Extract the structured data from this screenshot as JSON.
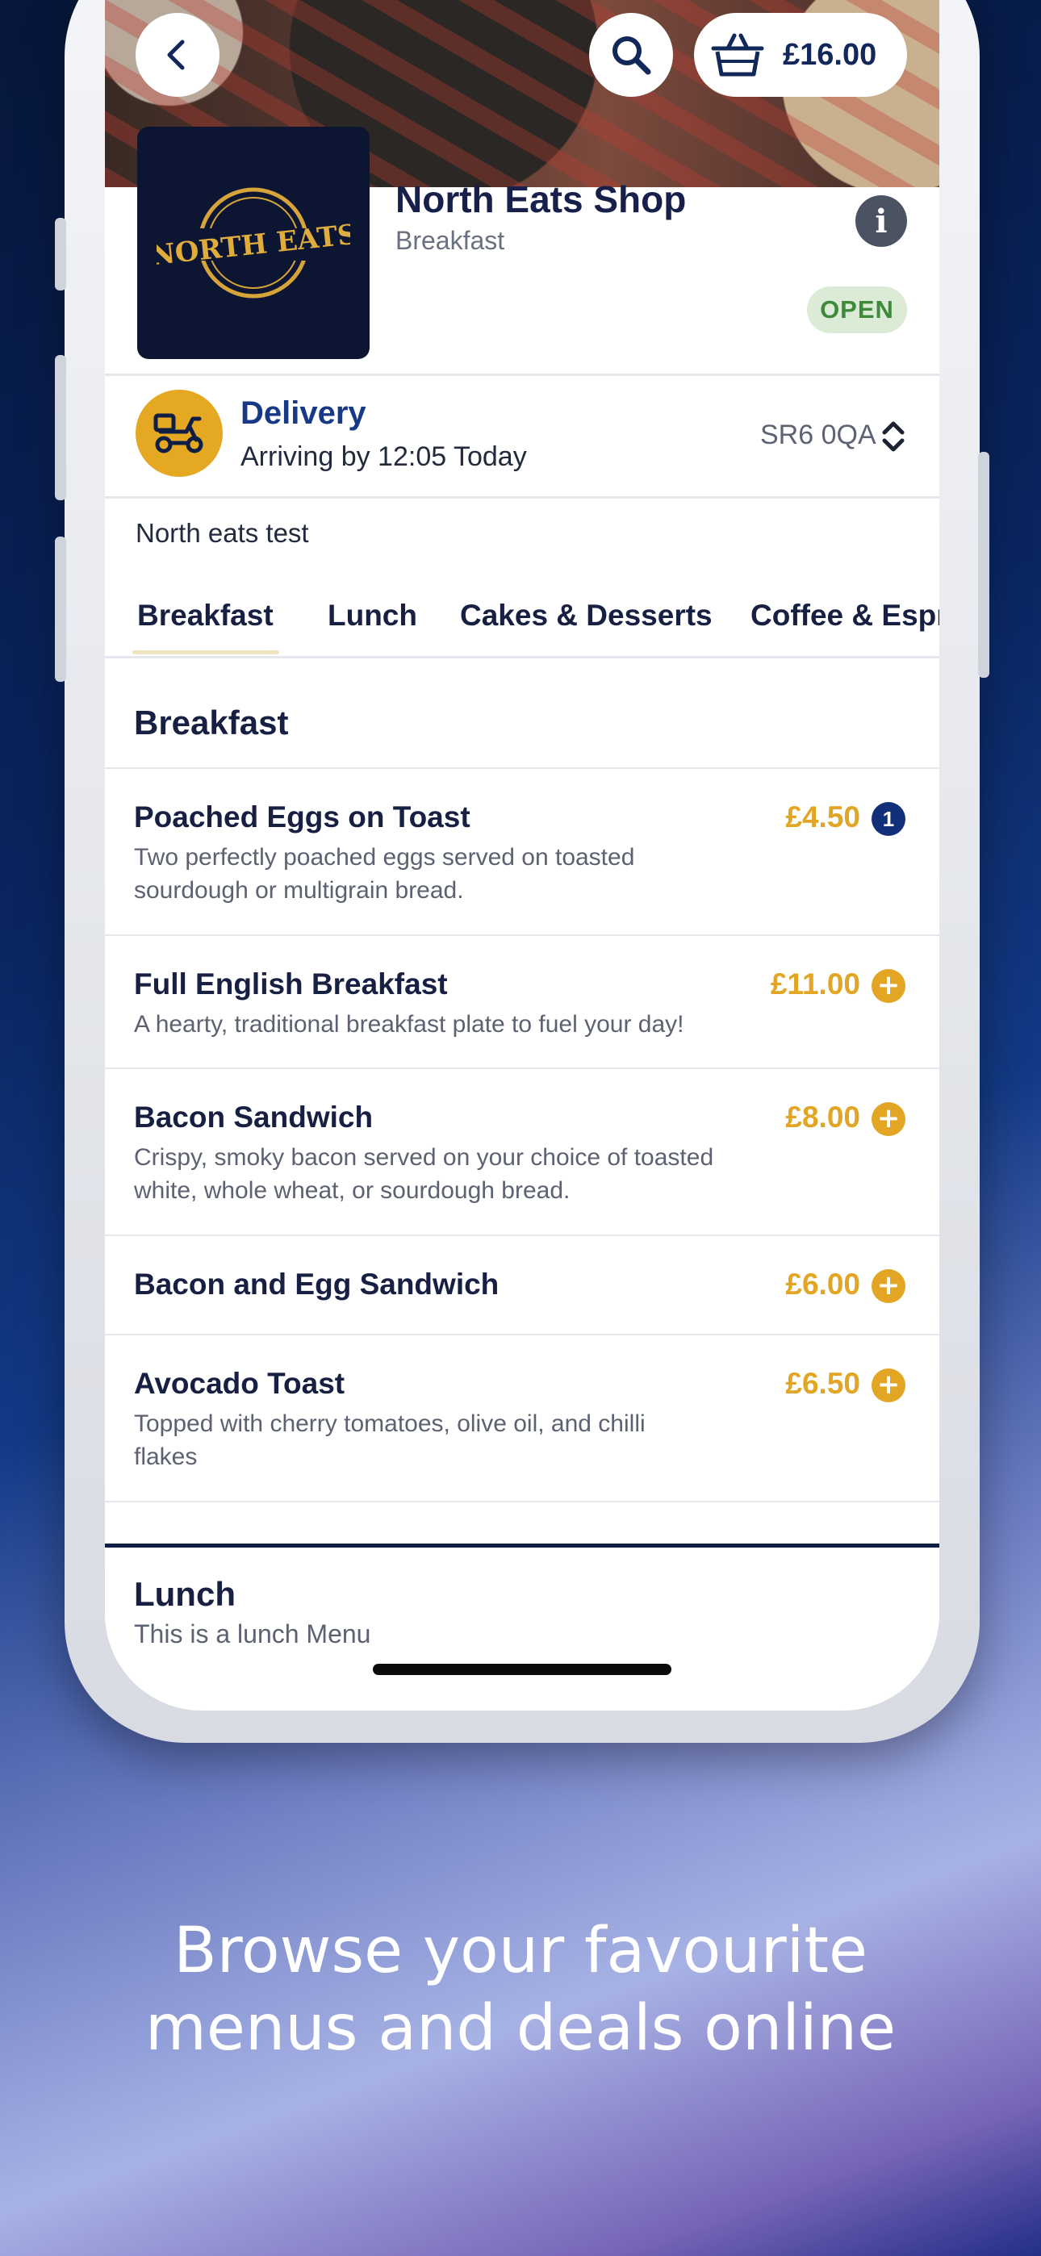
{
  "header": {
    "basket_total": "£16.00"
  },
  "shop": {
    "logo_text": "NORTH EATS",
    "name": "North Eats Shop",
    "category": "Breakfast",
    "status": "OPEN"
  },
  "delivery": {
    "title": "Delivery",
    "eta": "Arriving by 12:05 Today",
    "postcode": "SR6 0QA"
  },
  "menu_description": "North eats test",
  "tabs": [
    "Breakfast",
    "Lunch",
    "Cakes & Desserts",
    "Coffee & Espr"
  ],
  "active_tab": "Breakfast",
  "sections": [
    {
      "title": "Breakfast",
      "items": [
        {
          "name": "Poached Eggs on Toast",
          "desc": "Two perfectly poached eggs served on toasted sourdough or multigrain bread.",
          "price": "£4.50",
          "qty": "1"
        },
        {
          "name": "Full English Breakfast",
          "desc": "A hearty, traditional breakfast plate to fuel your day!",
          "price": "£11.00"
        },
        {
          "name": "Bacon Sandwich",
          "desc": "Crispy, smoky bacon served on your choice of toasted white, whole wheat, or sourdough bread.",
          "price": "£8.00"
        },
        {
          "name": "Bacon and Egg Sandwich",
          "desc": "",
          "price": "£6.00"
        },
        {
          "name": "Avocado Toast",
          "desc": "Topped with cherry tomatoes, olive oil, and chilli flakes",
          "price": "£6.50"
        }
      ]
    },
    {
      "title": "Lunch",
      "subtitle": "This is a lunch Menu"
    }
  ],
  "tagline": {
    "line1": "Browse your favourite",
    "line2": "menus and deals online"
  },
  "colors": {
    "accent": "#e2a524",
    "brand_navy": "#12307a",
    "open_green": "#3f8a3a"
  }
}
